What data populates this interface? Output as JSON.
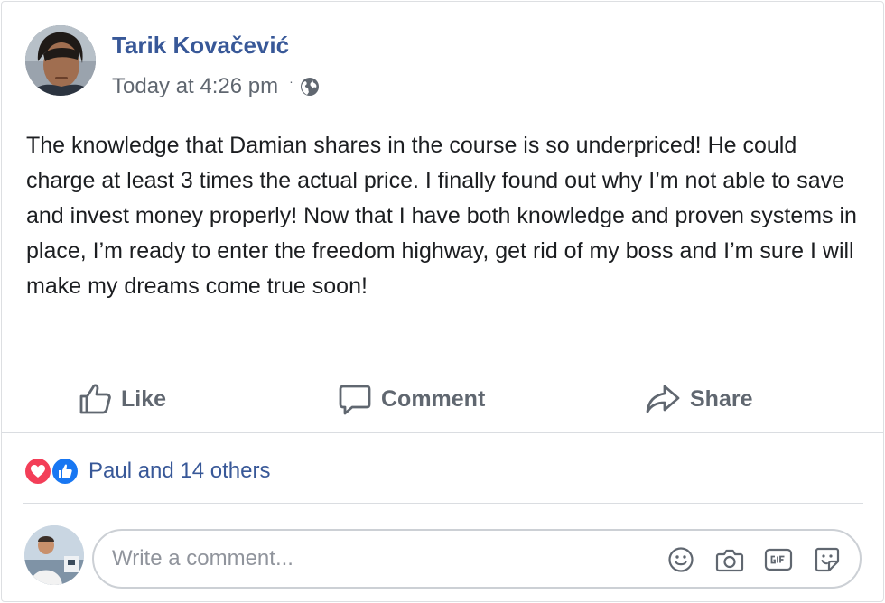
{
  "post": {
    "author": "Tarik Kovačević",
    "timestamp": "Today at 4:26 pm",
    "separator": "·",
    "privacy_icon": "globe-icon",
    "text": "The knowledge that Damian shares in the course is so underpriced! He could charge at least 3 times the actual price. I finally found out why I’m not able to save and invest money properly! Now that I have both knowledge and proven systems in place, I’m ready to enter the freedom highway, get rid of my boss and I’m sure I will make my dreams come true soon!"
  },
  "actions": {
    "like_label": "Like",
    "comment_label": "Comment",
    "share_label": "Share"
  },
  "reactions": {
    "types": [
      "love",
      "like"
    ],
    "summary": "Paul and 14 others"
  },
  "comment_box": {
    "placeholder": "Write a comment...",
    "icons": [
      "emoji-icon",
      "camera-icon",
      "gif-icon",
      "sticker-icon"
    ]
  },
  "colors": {
    "author_link": "#385898",
    "secondary_text": "#606770",
    "love": "#f33e58",
    "like": "#1877f2",
    "divider": "#dadde1"
  }
}
